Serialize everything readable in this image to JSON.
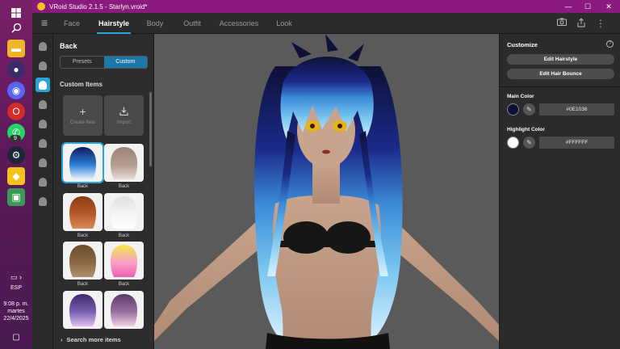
{
  "window": {
    "title": "VRoid Studio 2.1.5 - Starlyn.vroid*"
  },
  "nav": {
    "tabs": [
      {
        "label": "Face"
      },
      {
        "label": "Hairstyle"
      },
      {
        "label": "Body"
      },
      {
        "label": "Outfit"
      },
      {
        "label": "Accessories"
      },
      {
        "label": "Look"
      }
    ],
    "active_tab": "Hairstyle"
  },
  "left_panel": {
    "title": "Back",
    "segments": [
      "Presets",
      "Custom"
    ],
    "active_segment": "Custom",
    "section_label": "Custom Items",
    "actions": [
      {
        "label": "Create New",
        "icon": "plus-icon"
      },
      {
        "label": "Import",
        "icon": "import-icon"
      }
    ],
    "items": [
      {
        "label": "Back",
        "colors": [
          "#0e1a60",
          "#2a7fd4",
          "#e8f4ff"
        ]
      },
      {
        "label": "Back",
        "colors": [
          "#9a8478",
          "#b39c90",
          "#e8dcd6"
        ]
      },
      {
        "label": "Back",
        "colors": [
          "#8a3a14",
          "#b85a2a",
          "#d98a5a"
        ]
      },
      {
        "label": "Back",
        "colors": [
          "#e0e0e0",
          "#f4f4f4",
          "#ffffff"
        ]
      },
      {
        "label": "Back",
        "colors": [
          "#6a4a2a",
          "#8a6a44",
          "#b09070"
        ]
      },
      {
        "label": "Back",
        "colors": [
          "#f4e84a",
          "#f8a0c8",
          "#f060b0"
        ]
      },
      {
        "label": "",
        "colors": [
          "#3a2a6a",
          "#7a60b0",
          "#e0c0f0"
        ]
      },
      {
        "label": "",
        "colors": [
          "#5a3a6a",
          "#9a70a0",
          "#f0d0e0"
        ]
      }
    ],
    "search_more": "Search more items"
  },
  "right_panel": {
    "section": "Customize",
    "buttons": [
      "Edit Hairstyle",
      "Edit Hair Bounce"
    ],
    "main_color": {
      "label": "Main Color",
      "hex": "#0E1036",
      "swatch": "#0E1036"
    },
    "highlight_color": {
      "label": "Highlight Color",
      "hex": "#FFFFFF",
      "swatch": "#FFFFFF"
    }
  },
  "taskbar": {
    "lang": "ESP",
    "time": "9:08 p. m.",
    "day": "martes",
    "date": "22/4/2025",
    "badge": "9"
  },
  "colors": {
    "accent": "#2aa3d8",
    "titlebar": "#8b1a7e"
  }
}
